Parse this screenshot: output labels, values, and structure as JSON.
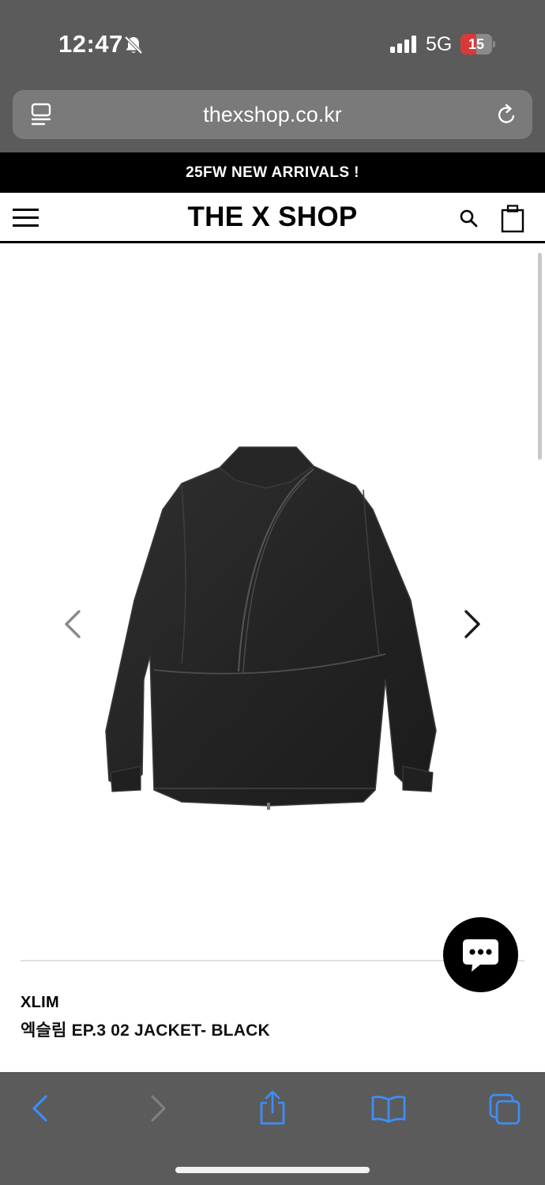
{
  "status_bar": {
    "time": "12:47",
    "network": "5G",
    "battery": "15",
    "icons": [
      "bell-slash-icon",
      "cellular-signal-icon",
      "battery-icon"
    ]
  },
  "browser": {
    "url": "thexshop.co.kr",
    "icons": [
      "reader-icon",
      "reload-icon"
    ]
  },
  "announcement": {
    "text": "25FW NEW ARRIVALS !"
  },
  "header": {
    "logo": "THE X SHOP",
    "icons": [
      "menu-icon",
      "search-icon",
      "shopping-bag-icon"
    ]
  },
  "gallery": {
    "icons": [
      "chevron-left-icon",
      "chevron-right-icon"
    ]
  },
  "product": {
    "brand": "XLIM",
    "name": "엑슬림 EP.3 02 JACKET- BLACK"
  },
  "chat": {
    "icon": "chat-bubble-icon"
  },
  "toolbar": {
    "icons": [
      "back-icon",
      "forward-icon",
      "share-icon",
      "bookmarks-icon",
      "tabs-icon"
    ]
  },
  "colors": {
    "chrome_bg": "#5b5b5b",
    "accent_blue": "#3d8df5",
    "battery_low": "#d83a3a",
    "announcement_bg": "#000000"
  }
}
